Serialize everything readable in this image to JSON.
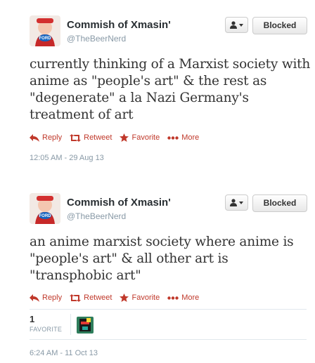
{
  "colors": {
    "accent": "#c0392b",
    "muted": "#8899a6",
    "border": "#e1e8ed"
  },
  "tweets": [
    {
      "name": "Commish of Xmasin'",
      "handle": "@TheBeerNerd",
      "avatar_text": "FORD",
      "blocked_label": "Blocked",
      "text": "currently thinking of a Marxist society with anime as \"people's art\" & the rest as \"degenerate\" a la Nazi Germany's treatment of art",
      "actions": {
        "reply": "Reply",
        "retweet": "Retweet",
        "favorite": "Favorite",
        "more": "More"
      },
      "timestamp": "12:05 AM - 29 Aug 13"
    },
    {
      "name": "Commish of Xmasin'",
      "handle": "@TheBeerNerd",
      "avatar_text": "FORD",
      "blocked_label": "Blocked",
      "text": "an anime marxist society where anime is \"people's art\" & all other art is \"transphobic art\"",
      "actions": {
        "reply": "Reply",
        "retweet": "Retweet",
        "favorite": "Favorite",
        "more": "More"
      },
      "favorites": {
        "count": "1",
        "label": "FAVORITE"
      },
      "timestamp": "6:24 AM - 11 Oct 13"
    }
  ]
}
